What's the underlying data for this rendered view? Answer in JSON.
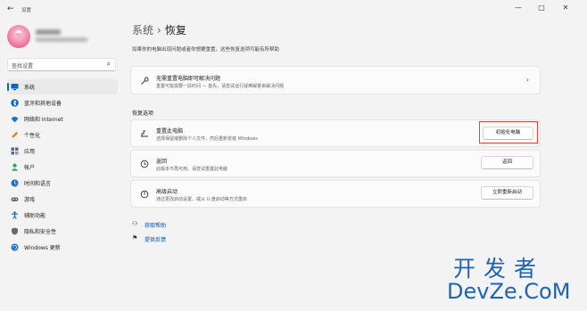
{
  "window": {
    "title": "设置",
    "back_icon": "back-arrow-icon",
    "minimize": "—",
    "maximize": "□",
    "close": "✕"
  },
  "search": {
    "placeholder": "查找设置",
    "icon": "search-icon"
  },
  "sidebar": {
    "items": [
      {
        "label": "系统",
        "icon": "monitor-icon",
        "color": "#0067c0",
        "active": true
      },
      {
        "label": "蓝牙和其他设备",
        "icon": "bluetooth-icon",
        "color": "#0067c0"
      },
      {
        "label": "网络和 Internet",
        "icon": "wifi-icon",
        "color": "#1a73c8"
      },
      {
        "label": "个性化",
        "icon": "pen-icon",
        "color": "#d97a1f"
      },
      {
        "label": "应用",
        "icon": "apps-icon",
        "color": "#5a6a8a"
      },
      {
        "label": "帐户",
        "icon": "person-icon",
        "color": "#2e9d5b"
      },
      {
        "label": "时间和语言",
        "icon": "globe-clock-icon",
        "color": "#1a73c8"
      },
      {
        "label": "游戏",
        "icon": "gamepad-icon",
        "color": "#6a6a6a"
      },
      {
        "label": "辅助功能",
        "icon": "accessibility-icon",
        "color": "#1a5fb4"
      },
      {
        "label": "隐私和安全性",
        "icon": "shield-icon",
        "color": "#6a6a6a"
      },
      {
        "label": "Windows 更新",
        "icon": "update-icon",
        "color": "#1a73c8"
      }
    ]
  },
  "breadcrumb": {
    "parent": "系统",
    "separator": "›",
    "current": "恢复"
  },
  "description": "如果你的电脑出现问题或者你想要重置，这些恢复选项可能有所帮助",
  "troubleshoot_card": {
    "title": "无需重置电脑即可解决问题",
    "subtitle": "重置可能需要一段时间 — 首先，请尝试运行疑难解答来解决问题",
    "icon": "wrench-icon"
  },
  "recovery_section": {
    "title": "恢复选项",
    "options": [
      {
        "title": "重置此电脑",
        "subtitle": "选择保留或删除个人文件，然后重新安装 Windows",
        "button": "初始化电脑",
        "icon": "reset-pc-icon"
      },
      {
        "title": "返回",
        "subtitle": "此版本不再可用，请尝试重置此电脑",
        "button": "返回",
        "icon": "history-icon"
      },
      {
        "title": "高级启动",
        "subtitle": "通过更改启动设置，或从 U 盘启动等方式重启",
        "button": "立即重新启动",
        "icon": "advanced-startup-icon"
      }
    ]
  },
  "links": [
    {
      "label": "获取帮助",
      "icon": "help-icon"
    },
    {
      "label": "提供反馈",
      "icon": "feedback-icon"
    }
  ],
  "watermark": {
    "cn": "开发者",
    "en": "DevZe.CoM",
    "color": "#1f63b5"
  },
  "highlight_color": "#e8443a"
}
